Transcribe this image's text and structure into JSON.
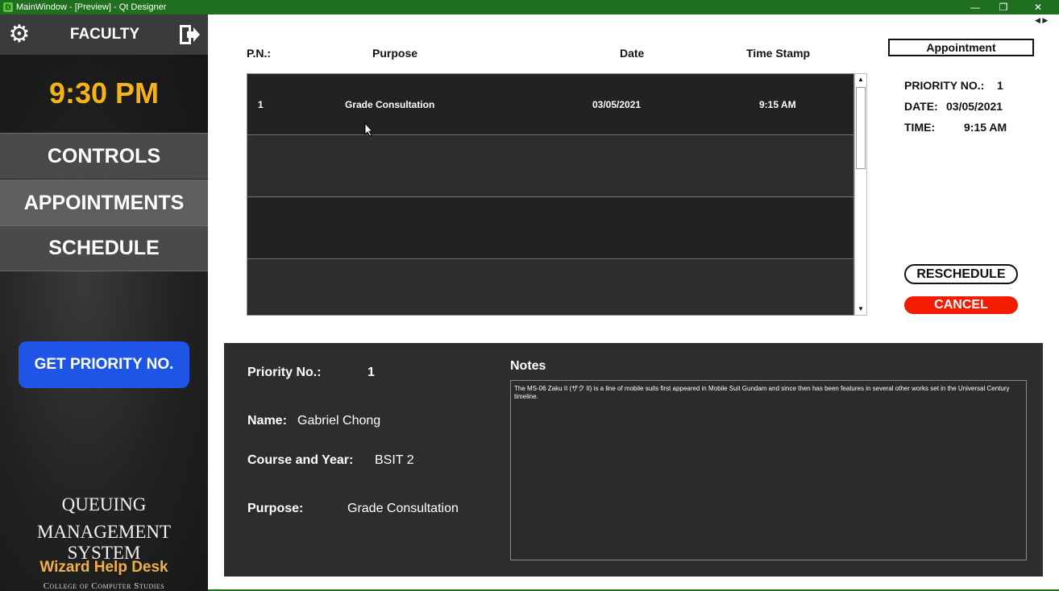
{
  "window": {
    "title": "MainWindow - [Preview] - Qt Designer",
    "app_icon_letter": "D",
    "minimize": "—",
    "restore": "❐",
    "close": "✕"
  },
  "sidebar": {
    "settings_icon": "gear-icon",
    "role": "FACULTY",
    "logout_icon": "logout-icon",
    "clock": "9:30 PM",
    "nav": {
      "controls": "CONTROLS",
      "appointments": "APPOINTMENTS",
      "schedule": "SCHEDULE"
    },
    "get_priority": "GET PRIORITY NO.",
    "brand_line1": "QUEUING",
    "brand_line2": "MANAGEMENT SYSTEM",
    "brand_name": "Wizard Help Desk",
    "brand_college": "College of Computer Studies",
    "colors": {
      "clock": "#f6b318",
      "priority_button": "#1e55e6"
    }
  },
  "table": {
    "headers": {
      "pn": "P.N.:",
      "purpose": "Purpose",
      "date": "Date",
      "timestamp": "Time Stamp"
    },
    "rows": [
      {
        "pn": "1",
        "purpose": "Grade Consultation",
        "date": "03/05/2021",
        "time": "9:15 AM"
      },
      {
        "pn": "",
        "purpose": "",
        "date": "",
        "time": ""
      },
      {
        "pn": "",
        "purpose": "",
        "date": "",
        "time": ""
      },
      {
        "pn": "",
        "purpose": "",
        "date": "",
        "time": ""
      }
    ],
    "scroll_up": "▲",
    "scroll_down": "▼"
  },
  "appointment": {
    "header": "Appointment",
    "priority_label": "PRIORITY NO.:",
    "priority_value": "1",
    "date_label": "DATE:",
    "date_value": "03/05/2021",
    "time_label": "TIME:",
    "time_value": "9:15 AM",
    "reschedule": "RESCHEDULE",
    "cancel": "CANCEL",
    "colors": {
      "cancel": "#f41c00"
    }
  },
  "details": {
    "priority_label": "Priority No.:",
    "priority_value": "1",
    "name_label": "Name:",
    "name_value": "Gabriel Chong",
    "course_label": "Course and Year:",
    "course_value": "BSIT 2",
    "purpose_label": "Purpose:",
    "purpose_value": "Grade Consultation",
    "notes_label": "Notes",
    "notes_text": "The MS-06 Zaku II (ザク II) is a line of mobile suits first appeared in Mobile Suit Gundam and since then has been features in several other works set in the Universal Century timeline."
  },
  "tab_arrows": "◀ ▶"
}
